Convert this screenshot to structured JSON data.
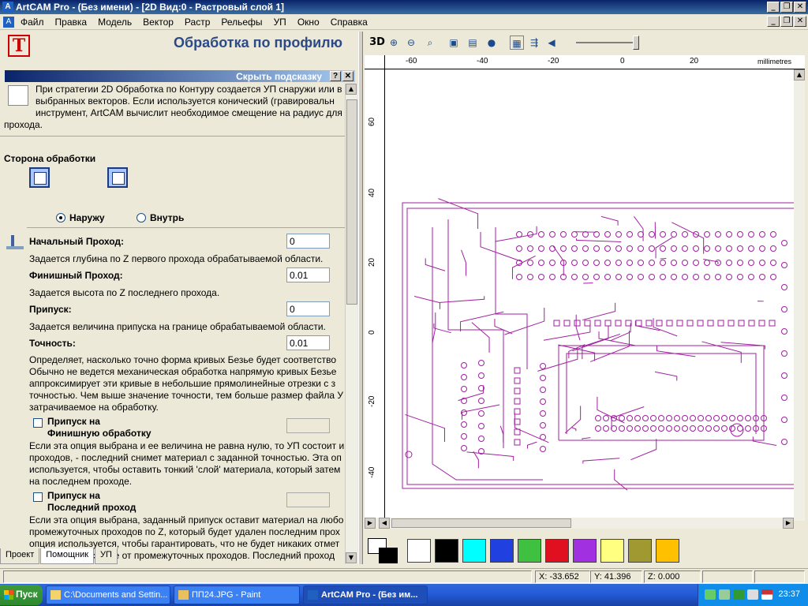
{
  "window": {
    "title": "ArtCAM Pro - (Без имени) - [2D Вид:0 - Растровый слой 1]",
    "app_icon": "A"
  },
  "menu": [
    "Файл",
    "Правка",
    "Модель",
    "Вектор",
    "Растр",
    "Рельефы",
    "УП",
    "Окно",
    "Справка"
  ],
  "panel": {
    "title": "Обработка по профилю",
    "logo": "T",
    "hide_hint": "Скрыть подсказку",
    "help_btn": "?",
    "close_btn": "✕",
    "hint_lines": [
      "При стратегии 2D Обработка по Контуру создается УП снаружи или в",
      "выбранных векторов. Если используется конический (гравировальн",
      "инструмент, ArtCAM вычислит необходимое смещение на радиус для",
      "прохода."
    ],
    "side_label": "Сторона обработки",
    "outside": "Наружу",
    "inside": "Внутрь",
    "start_pass": "Начальный Проход:",
    "start_pass_value": "0",
    "start_pass_desc": "Задается глубина по Z первого прохода обрабатываемой области.",
    "finish_pass": "Финишный Проход:",
    "finish_pass_value": "0.01",
    "finish_pass_desc": "Задается высота по Z последнего прохода.",
    "allowance": "Припуск:",
    "allowance_value": "0",
    "allowance_desc": "Задается величина припуска на границе обрабатываемой области.",
    "tolerance": "Точность:",
    "tolerance_value": "0.01",
    "tolerance_desc": [
      "Определяет, насколько точно форма кривых Безье будет соответство",
      "Обычно не ведется механическая обработка напрямую кривых Безье",
      "аппроксимирует эти кривые в небольшие прямолинейные отрезки с з",
      "точностью. Чем выше значение точности, тем больше размер файла У",
      "затрачиваемое на обработку."
    ],
    "finish_allow_l1": "Припуск на",
    "finish_allow_l2": "Финишную обработку",
    "finish_allow_desc": [
      "Если эта опция выбрана и ее величина не равна нулю, то УП состоит и",
      "проходов, - последний снимет материал с заданной точностью. Эта оп",
      "используется, чтобы оставить тонкий 'слой' материала, который затем",
      "на последнем проходе."
    ],
    "last_allow_l1": "Припуск на",
    "last_allow_l2": "Последний проход",
    "last_allow_desc": [
      "Если эта опция выбрана, заданный припуск оставит материал на любо",
      "промежуточных проходов по Z, который будет удален последним прох",
      "опция используется, чтобы гарантировать, что не будет никаких отмет",
      "обработки на станке от промежуточных проходов. Последний проход"
    ]
  },
  "tabs": [
    "Проект",
    "Помощник",
    "УП"
  ],
  "view": {
    "mode_3d": "3D",
    "units": "millimetres",
    "h_ticks": [
      "-60",
      "-40",
      "-20",
      "0",
      "20"
    ],
    "v_ticks": [
      "60",
      "40",
      "20",
      "0",
      "-20",
      "-40"
    ],
    "trace_color": "#a020a0"
  },
  "palette": [
    "#ffffff",
    "#000000",
    "#00ffff",
    "#2040e0",
    "#40c040",
    "#e01020",
    "#a030e0",
    "#ffff80",
    "#a09830",
    "#ffc000"
  ],
  "status": {
    "x": "X: -33.652",
    "y": "Y: 41.396",
    "z": "Z: 0.000"
  },
  "taskbar": {
    "start": "Пуск",
    "tasks": [
      "C:\\Documents and Settin...",
      "ПП24.JPG - Paint",
      "ArtCAM Pro - (Без им..."
    ],
    "clock": "23:37"
  }
}
